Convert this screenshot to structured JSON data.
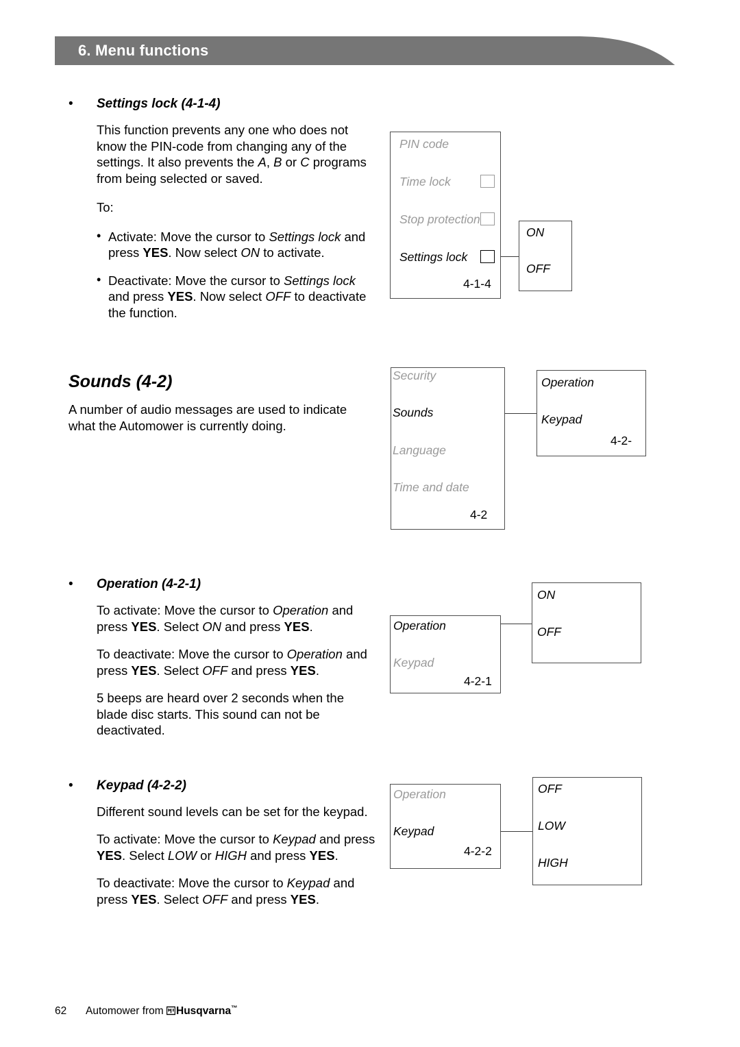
{
  "header": {
    "title": "6. Menu functions",
    "bar_color": "#767676"
  },
  "content": {
    "settings_lock": {
      "bullet": "•",
      "heading": "Settings lock (4-1-4)",
      "paragraph_1_a": "This function prevents any one who does not know the PIN-code from changing any of the settings. It also prevents the ",
      "paragraph_1_i1": "A",
      "paragraph_1_b": ", ",
      "paragraph_1_i2": "B",
      "paragraph_1_c": " or ",
      "paragraph_1_i3": "C",
      "paragraph_1_d": " programs from being selected or saved.",
      "to_label": "To:",
      "items": [
        {
          "bullet": "•",
          "a": "Activate: Move the cursor to ",
          "i1": "Settings lock",
          "b": " and press ",
          "bold1": "YES",
          "c": ". Now select ",
          "i2": "ON",
          "d": " to activate."
        },
        {
          "bullet": "•",
          "a": "Deactivate: Move the cursor to ",
          "i1": "Settings lock",
          "b": " and press ",
          "bold1": "YES",
          "c": ". Now select ",
          "i2": "OFF",
          "d": " to deactivate the function."
        }
      ]
    },
    "sounds": {
      "heading": "Sounds (4-2)",
      "paragraph": "A number of audio messages are used to indicate what the Automower is currently doing."
    },
    "operation": {
      "bullet": "•",
      "heading": "Operation (4-2-1)",
      "p1_a": "To activate: Move the cursor to ",
      "p1_i1": "Operation",
      "p1_b": " and press ",
      "p1_bold1": "YES",
      "p1_c": ". Select ",
      "p1_i2": "ON",
      "p1_d": " and press ",
      "p1_bold2": "YES",
      "p1_e": ".",
      "p2_a": "To deactivate: Move the cursor to ",
      "p2_i1": "Operation",
      "p2_b": " and press ",
      "p2_bold1": "YES",
      "p2_c": ". Select ",
      "p2_i2": "OFF",
      "p2_d": " and press ",
      "p2_bold2": "YES",
      "p2_e": ".",
      "p3": "5 beeps are heard over 2 seconds when the blade disc starts. This sound can not be deactivated."
    },
    "keypad": {
      "bullet": "•",
      "heading": "Keypad (4-2-2)",
      "p1": "Different sound levels can be set for the keypad.",
      "p2_a": "To activate: Move the cursor to ",
      "p2_i1": "Keypad",
      "p2_b": " and press ",
      "p2_bold1": "YES",
      "p2_c": ". Select ",
      "p2_i2": "LOW",
      "p2_d": " or ",
      "p2_i3": "HIGH",
      "p2_e": " and press ",
      "p2_bold2": "YES",
      "p2_f": ".",
      "p3_a": "To deactivate: Move the cursor to ",
      "p3_i1": "Keypad",
      "p3_b": " and press ",
      "p3_bold1": "YES",
      "p3_c": ". Select ",
      "p3_i2": "OFF",
      "p3_d": " and press ",
      "p3_bold2": "YES",
      "p3_e": "."
    }
  },
  "diagrams": {
    "settings_lock": {
      "menu_items": [
        {
          "label": "PIN code",
          "state": "dim",
          "checkbox": false
        },
        {
          "label": "Time lock",
          "state": "dim",
          "checkbox": true
        },
        {
          "label": "Stop protection",
          "state": "dim",
          "checkbox": true
        },
        {
          "label": "Settings lock",
          "state": "on",
          "checkbox": true
        }
      ],
      "code": "4-1-4",
      "options": [
        "ON",
        "OFF"
      ]
    },
    "sounds": {
      "menu_items": [
        {
          "label": "Security",
          "state": "dim"
        },
        {
          "label": "Sounds",
          "state": "on"
        },
        {
          "label": "Language",
          "state": "dim"
        },
        {
          "label": "Time and date",
          "state": "dim"
        }
      ],
      "code": "4-2",
      "sub_items": [
        {
          "label": "Operation",
          "state": "on"
        },
        {
          "label": "Keypad",
          "state": "on"
        }
      ],
      "sub_code": "4-2-"
    },
    "operation": {
      "menu_items": [
        {
          "label": "Operation",
          "state": "on"
        },
        {
          "label": "Keypad",
          "state": "dim"
        }
      ],
      "code": "4-2-1",
      "options": [
        "ON",
        "OFF"
      ]
    },
    "keypad": {
      "menu_items": [
        {
          "label": "Operation",
          "state": "dim"
        },
        {
          "label": "Keypad",
          "state": "on"
        }
      ],
      "code": "4-2-2",
      "options": [
        "OFF",
        "LOW",
        "HIGH"
      ]
    }
  },
  "footer": {
    "page_number": "62",
    "text": "Automower from",
    "brand": "Husqvarna",
    "tm": "™"
  }
}
